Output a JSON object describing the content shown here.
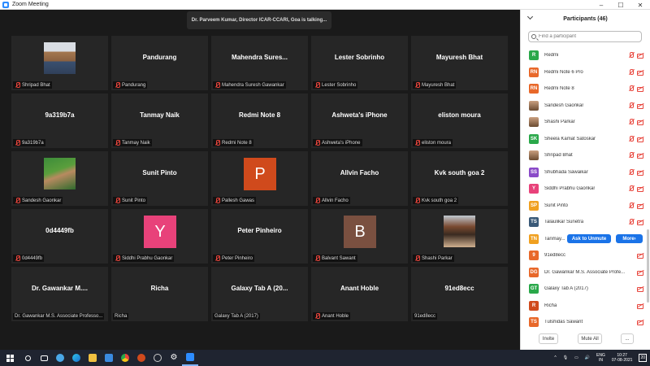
{
  "window": {
    "title": "Zoom Meeting",
    "controls": [
      "–",
      "☐",
      "✕"
    ]
  },
  "talking_banner": "Dr. Parveem Kumar, Director ICAR-CCARI, Goa is talking...",
  "tiles": [
    {
      "big": "",
      "label": "Shripad Bhat",
      "kind": "photo",
      "photo": "person1"
    },
    {
      "big": "Pandurang",
      "label": "Pandurang",
      "kind": "name"
    },
    {
      "big": "Mahendra Sures...",
      "label": "Mahendra Suresh Gawankar",
      "kind": "name"
    },
    {
      "big": "Lester Sobrinho",
      "label": "Lester Sobrinho",
      "kind": "name"
    },
    {
      "big": "Mayuresh Bhat",
      "label": "Mayuresh Bhat",
      "kind": "name"
    },
    {
      "big": "9a319b7a",
      "label": "9a319b7a",
      "kind": "name"
    },
    {
      "big": "Tanmay Naik",
      "label": "Tanmay Naik",
      "kind": "name"
    },
    {
      "big": "Redmi Note 8",
      "label": "Redmi Note 8",
      "kind": "name"
    },
    {
      "big": "Ashweta's iPhone",
      "label": "Ashweta's iPhone",
      "kind": "name"
    },
    {
      "big": "eliston moura",
      "label": "eliston moura",
      "kind": "name"
    },
    {
      "big": "",
      "label": "Sandesh Gaonkar",
      "kind": "photo",
      "photo": "person2"
    },
    {
      "big": "Sunit Pinto",
      "label": "Sunit Pinto",
      "kind": "name"
    },
    {
      "big": "P",
      "label": "Pallesh Gawas",
      "kind": "letter",
      "color": "#d04a1c"
    },
    {
      "big": "Allvin Facho",
      "label": "Allvin Facho",
      "kind": "name"
    },
    {
      "big": "Kvk south goa 2",
      "label": "Kvk south goa 2",
      "kind": "name"
    },
    {
      "big": "0d4449fb",
      "label": "0d4449fb",
      "kind": "name"
    },
    {
      "big": "Y",
      "label": "Siddhi Prabhu Gaonkar",
      "kind": "letter",
      "color": "#e8427a"
    },
    {
      "big": "Peter Pinheiro",
      "label": "Peter Pinheiro",
      "kind": "name"
    },
    {
      "big": "B",
      "label": "Balvant Sawant",
      "kind": "letter",
      "color": "#7a5040"
    },
    {
      "big": "",
      "label": "Shashi Parkar",
      "kind": "photo",
      "photo": "person3"
    },
    {
      "big": "Dr. Gawankar M....",
      "label": "Dr. Gawankar M.S. Associate Professo...",
      "kind": "name",
      "nomic": true
    },
    {
      "big": "Richa",
      "label": "Richa",
      "kind": "name",
      "nomic": true
    },
    {
      "big": "Galaxy Tab A (20...",
      "label": "Galaxy Tab A (2017)",
      "kind": "name",
      "nomic": true
    },
    {
      "big": "Anant Hoble",
      "label": "Anant Hoble",
      "kind": "name"
    },
    {
      "big": "91ed8ecc",
      "label": "91ed8ecc",
      "kind": "name",
      "nomic": true
    }
  ],
  "participants": {
    "title": "Participants (46)",
    "search_placeholder": "Find a participant",
    "list": [
      {
        "initials": "R",
        "color": "#2aa84a",
        "name": "Redmi",
        "mic": true
      },
      {
        "initials": "RN",
        "color": "#e8682a",
        "name": "Redmi Note 6 Pro",
        "mic": true
      },
      {
        "initials": "RN",
        "color": "#e8682a",
        "name": "Redmi Note 8",
        "mic": true
      },
      {
        "initials": "",
        "color": "#8a6a40",
        "name": "Sandesh Gaonkar",
        "mic": true
      },
      {
        "initials": "",
        "color": "#8a6a40",
        "name": "Shashi Parkar",
        "mic": true
      },
      {
        "initials": "SK",
        "color": "#2aa84a",
        "name": "Sheela Kamat Satoskar",
        "mic": true
      },
      {
        "initials": "",
        "color": "#8a6a40",
        "name": "Shripad Bhat",
        "mic": true
      },
      {
        "initials": "SS",
        "color": "#8a4ac8",
        "name": "Shubhada Sawaikar",
        "mic": true
      },
      {
        "initials": "Y",
        "color": "#e8427a",
        "name": "Siddhi Prabhu Gaonkar",
        "mic": true
      },
      {
        "initials": "SP",
        "color": "#f0a020",
        "name": "Sunit Pinto",
        "mic": true
      },
      {
        "initials": "TS",
        "color": "#3a5a78",
        "name": "Talaulikar Sunetra",
        "mic": true
      },
      {
        "initials": "TN",
        "color": "#f0a020",
        "name": "Tanmay...",
        "mic": false,
        "hover": true
      },
      {
        "initials": "9",
        "color": "#e8682a",
        "name": "91ed8ecc",
        "mic": false
      },
      {
        "initials": "DG",
        "color": "#e8682a",
        "name": "Dr. Gawankar M.S. Associate Profe...",
        "mic": false
      },
      {
        "initials": "GT",
        "color": "#2aa84a",
        "name": "Galaxy Tab A (2017)",
        "mic": false
      },
      {
        "initials": "R",
        "color": "#d04a1c",
        "name": "Richa",
        "mic": false
      },
      {
        "initials": "TS",
        "color": "#e8682a",
        "name": "Tulshidas Sawant",
        "mic": false
      }
    ],
    "ask_to_unmute": "Ask to Unmute",
    "more": "More",
    "invite": "Invite",
    "mute_all": "Mute All",
    "ellipsis": "..."
  },
  "taskbar": {
    "lang": "ENG",
    "region": "IN",
    "time": "10:27",
    "date": "07-08-2021",
    "notifications": "20"
  }
}
